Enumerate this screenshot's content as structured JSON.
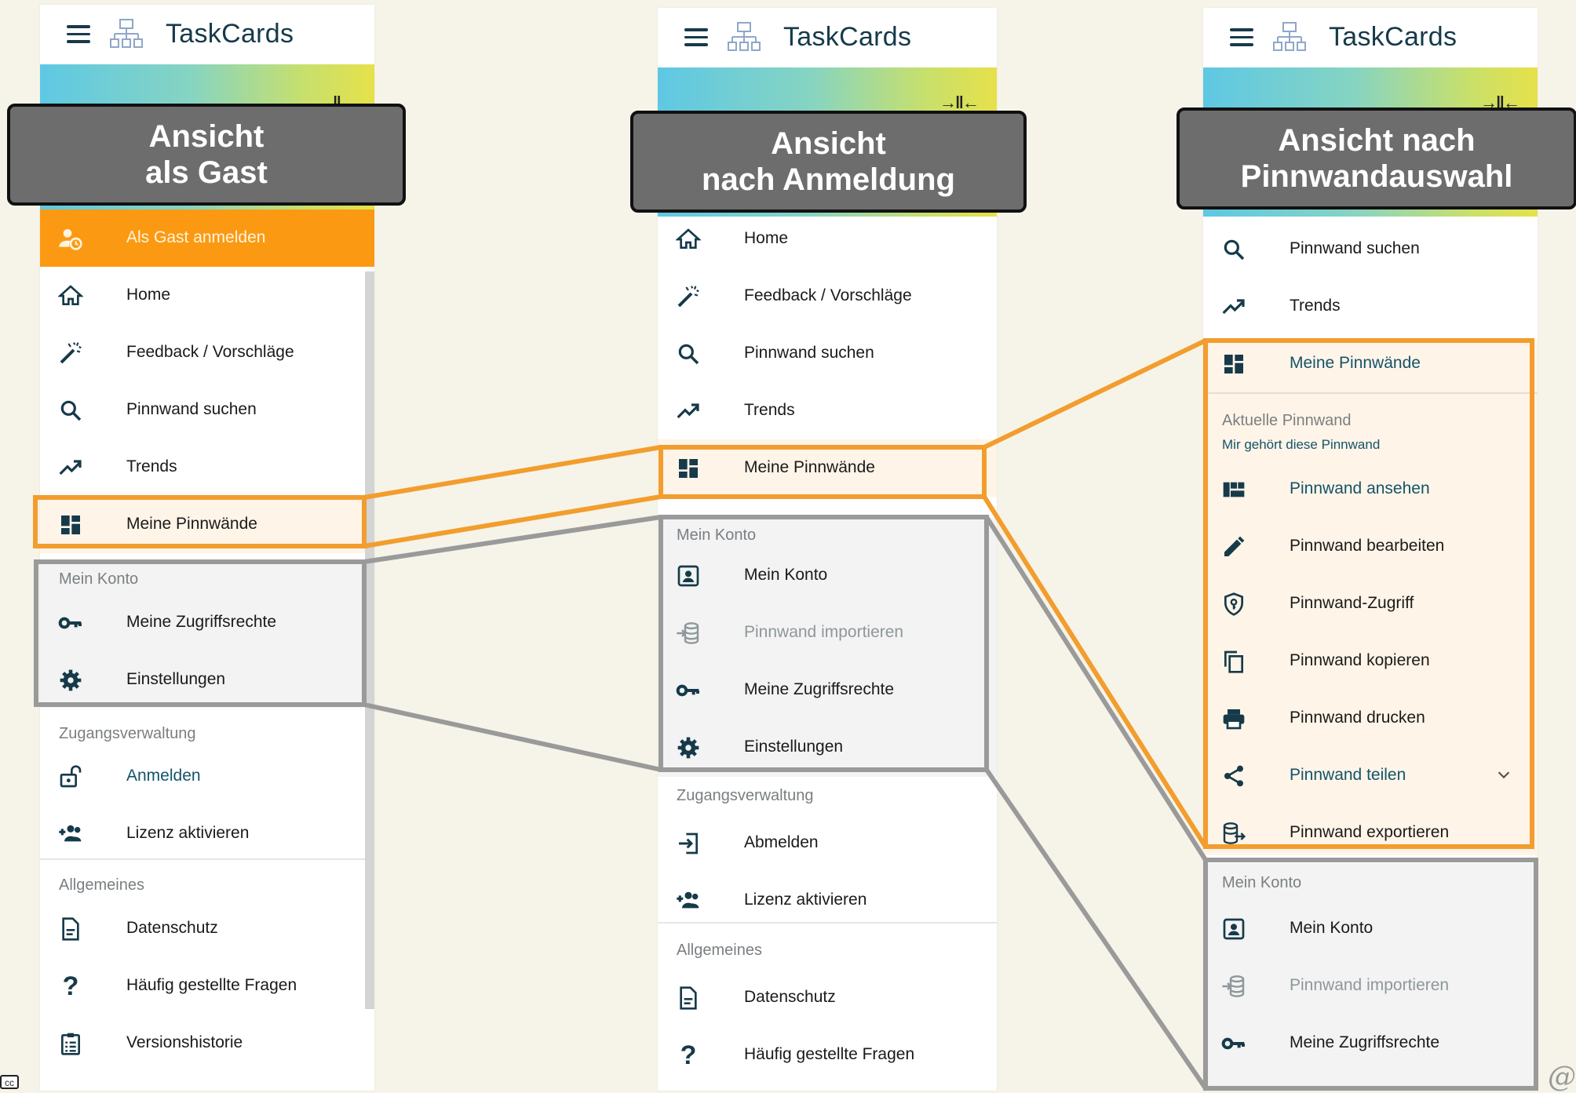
{
  "app_title": "TaskCards",
  "callouts": {
    "guest_line1": "Ansicht",
    "guest_line2": "als Gast",
    "login_line1": "Ansicht",
    "login_line2": "nach Anmeldung",
    "board_line1": "Ansicht nach",
    "board_line2": "Pinnwandauswahl"
  },
  "guest": {
    "items": [
      {
        "label": "Als Gast anmelden",
        "icon": "guest-login-icon"
      },
      {
        "label": "Home",
        "icon": "home-icon"
      },
      {
        "label": "Feedback / Vorschläge",
        "icon": "magic-wand-icon"
      },
      {
        "label": "Pinnwand suchen",
        "icon": "search-icon"
      },
      {
        "label": "Trends",
        "icon": "trending-icon"
      },
      {
        "label": "Meine Pinnwände",
        "icon": "dashboard-icon"
      },
      {
        "label": "Meine Zugriffsrechte",
        "icon": "key-icon"
      },
      {
        "label": "Einstellungen",
        "icon": "gear-icon"
      },
      {
        "label": "Anmelden",
        "icon": "unlock-icon"
      },
      {
        "label": "Lizenz aktivieren",
        "icon": "add-users-icon"
      },
      {
        "label": "Datenschutz",
        "icon": "document-icon"
      },
      {
        "label": "Häufig gestellte Fragen",
        "icon": "question-icon"
      },
      {
        "label": "Versionshistorie",
        "icon": "clipboard-list-icon"
      }
    ],
    "sections": {
      "account": "Mein Konto",
      "access": "Zugangsverwaltung",
      "general": "Allgemeines"
    }
  },
  "login": {
    "items": [
      {
        "label": "Home",
        "icon": "home-icon"
      },
      {
        "label": "Feedback / Vorschläge",
        "icon": "magic-wand-icon"
      },
      {
        "label": "Pinnwand suchen",
        "icon": "search-icon"
      },
      {
        "label": "Trends",
        "icon": "trending-icon"
      },
      {
        "label": "Meine Pinnwände",
        "icon": "dashboard-icon"
      },
      {
        "label": "Mein Konto",
        "icon": "account-box-icon"
      },
      {
        "label": "Pinnwand importieren",
        "icon": "import-icon"
      },
      {
        "label": "Meine Zugriffsrechte",
        "icon": "key-icon"
      },
      {
        "label": "Einstellungen",
        "icon": "gear-icon"
      },
      {
        "label": "Abmelden",
        "icon": "logout-icon"
      },
      {
        "label": "Lizenz aktivieren",
        "icon": "add-users-icon"
      },
      {
        "label": "Datenschutz",
        "icon": "document-icon"
      },
      {
        "label": "Häufig gestellte Fragen",
        "icon": "question-icon"
      }
    ],
    "sections": {
      "account": "Mein Konto",
      "access": "Zugangsverwaltung",
      "general": "Allgemeines"
    }
  },
  "board": {
    "items": [
      {
        "label": "Pinnwand suchen",
        "icon": "search-icon"
      },
      {
        "label": "Trends",
        "icon": "trending-icon"
      },
      {
        "label": "Meine Pinnwände",
        "icon": "dashboard-icon"
      },
      {
        "label": "Pinnwand ansehen",
        "icon": "view-quilt-icon"
      },
      {
        "label": "Pinnwand bearbeiten",
        "icon": "pencil-icon"
      },
      {
        "label": "Pinnwand-Zugriff",
        "icon": "shield-key-icon"
      },
      {
        "label": "Pinnwand kopieren",
        "icon": "copy-icon"
      },
      {
        "label": "Pinnwand drucken",
        "icon": "printer-icon"
      },
      {
        "label": "Pinnwand teilen",
        "icon": "share-icon"
      },
      {
        "label": "Pinnwand exportieren",
        "icon": "export-icon"
      },
      {
        "label": "Mein Konto",
        "icon": "account-box-icon"
      },
      {
        "label": "Pinnwand importieren",
        "icon": "import-icon"
      },
      {
        "label": "Meine Zugriffsrechte",
        "icon": "key-icon"
      }
    ],
    "sections": {
      "current": "Aktuelle Pinnwand",
      "owner": "Mir gehört diese Pinnwand",
      "account": "Mein Konto"
    }
  },
  "footer": {
    "license_badge": "cc",
    "at_sign": "@"
  },
  "colors": {
    "orange": "#f29d2e",
    "gray_frame": "#9a9a9a",
    "teal": "#13546a",
    "callout_bg": "#6d6d6d"
  }
}
